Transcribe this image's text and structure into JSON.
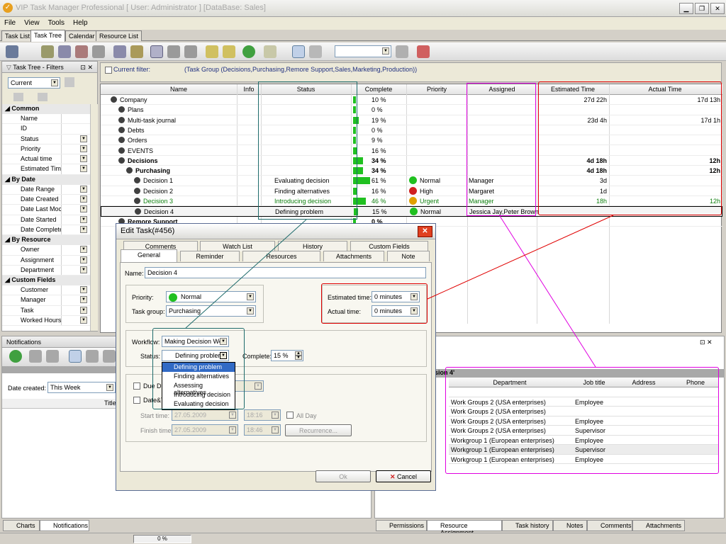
{
  "window": {
    "title": "VIP Task Manager Professional [ User: Administrator ] [DataBase: Sales]"
  },
  "menu": [
    "File",
    "View",
    "Tools",
    "Help"
  ],
  "view_tabs": [
    "Task List",
    "Task Tree",
    "Calendar",
    "Resource List"
  ],
  "filters_panel": {
    "title": "Task Tree - Filters",
    "current": "Current",
    "groups": [
      {
        "name": "Common",
        "items": [
          "Name",
          "ID",
          "Status",
          "Priority",
          "Actual time",
          "Estimated Tim"
        ]
      },
      {
        "name": "By Date",
        "items": [
          "Date Range",
          "Date Created",
          "Date Last Moc",
          "Date Started",
          "Date Complete"
        ]
      },
      {
        "name": "By Resource",
        "items": [
          "Owner",
          "Assignment",
          "Department"
        ]
      },
      {
        "name": "Custom Fields",
        "items": [
          "Customer",
          "Manager",
          "Task",
          "Worked Hours"
        ]
      }
    ]
  },
  "current_filter": {
    "label": "Current filter:",
    "value": "(Task Group  (Decisions,Purchasing,Remore Support,Sales,Marketing,Production))"
  },
  "task_grid": {
    "columns": [
      "Name",
      "Info",
      "Status",
      "Complete",
      "Priority",
      "Assigned",
      "Estimated Time",
      "Actual Time"
    ],
    "rows": [
      {
        "name": "Company",
        "status": "",
        "complete": "10 %",
        "pct": 10,
        "priority": "",
        "assigned": "",
        "est": "27d 22h",
        "act": "17d 13h",
        "bold": false,
        "indent": 0
      },
      {
        "name": "Plans",
        "status": "",
        "complete": "0 %",
        "pct": 0,
        "priority": "",
        "assigned": "",
        "est": "",
        "act": "",
        "bold": false,
        "indent": 1
      },
      {
        "name": "Multi-task journal",
        "status": "",
        "complete": "19 %",
        "pct": 19,
        "priority": "",
        "assigned": "",
        "est": "23d 4h",
        "act": "17d 1h",
        "bold": false,
        "indent": 1
      },
      {
        "name": "Debts",
        "status": "",
        "complete": "0 %",
        "pct": 0,
        "priority": "",
        "assigned": "",
        "est": "",
        "act": "",
        "bold": false,
        "indent": 1
      },
      {
        "name": "Orders",
        "status": "",
        "complete": "9 %",
        "pct": 9,
        "priority": "",
        "assigned": "",
        "est": "",
        "act": "",
        "bold": false,
        "indent": 1
      },
      {
        "name": "EVENTS",
        "status": "",
        "complete": "16 %",
        "pct": 16,
        "priority": "",
        "assigned": "",
        "est": "",
        "act": "",
        "bold": false,
        "indent": 1
      },
      {
        "name": "Decisions",
        "status": "",
        "complete": "34 %",
        "pct": 34,
        "priority": "",
        "assigned": "",
        "est": "4d 18h",
        "act": "12h",
        "bold": true,
        "indent": 1
      },
      {
        "name": "Purchasing",
        "status": "",
        "complete": "34 %",
        "pct": 34,
        "priority": "",
        "assigned": "",
        "est": "4d 18h",
        "act": "12h",
        "bold": true,
        "indent": 2
      },
      {
        "name": "Decision 1",
        "status": "Evaluating decision",
        "complete": "61 %",
        "pct": 61,
        "priority": "Normal",
        "assigned": "Manager",
        "est": "3d",
        "act": "",
        "bold": false,
        "indent": 3
      },
      {
        "name": "Decision 2",
        "status": "Finding alternatives",
        "complete": "16 %",
        "pct": 16,
        "priority": "High",
        "assigned": "Margaret",
        "est": "1d",
        "act": "",
        "bold": false,
        "indent": 3
      },
      {
        "name": "Decision 3",
        "status": "Introducing decision",
        "complete": "46 %",
        "pct": 46,
        "priority": "Urgent",
        "assigned": "Manager",
        "est": "18h",
        "act": "12h",
        "bold": false,
        "indent": 3,
        "green": true
      },
      {
        "name": "Decision 4",
        "status": "Defining problem",
        "complete": "15 %",
        "pct": 15,
        "priority": "Normal",
        "assigned": "Jessica Jay,Peter Brown",
        "est": "",
        "act": "",
        "bold": false,
        "indent": 3,
        "selected": true
      },
      {
        "name": "Remore Support",
        "status": "",
        "complete": "0 %",
        "pct": 0,
        "priority": "",
        "assigned": "",
        "est": "",
        "act": "",
        "bold": true,
        "indent": 1
      }
    ]
  },
  "notifications": {
    "title": "Notifications",
    "date_created_label": "Date created:",
    "date_created_value": "This Week",
    "col_title": "Title"
  },
  "left_bottom_tabs": [
    "Charts",
    "Notifications"
  ],
  "resource_panel": {
    "header": "sion 4'",
    "columns": [
      "Department",
      "Job title",
      "Address",
      "Phone"
    ],
    "rows": [
      {
        "dept": "",
        "job": ""
      },
      {
        "dept": "Work Groups 2 (USA enterprises)",
        "job": "Employee"
      },
      {
        "dept": "Work Groups 2 (USA enterprises)",
        "job": ""
      },
      {
        "dept": "Work Groups 2 (USA enterprises)",
        "job": "Employee"
      },
      {
        "dept": "Work Groups 2 (USA enterprises)",
        "job": "Supervisor"
      },
      {
        "dept": "Workgroup 1 (European enterprises)",
        "job": "Employee"
      },
      {
        "dept": "Workgroup 1 (European enterprises)",
        "job": "Supervisor"
      },
      {
        "dept": "Workgroup 1 (European enterprises)",
        "job": "Employee"
      }
    ],
    "tabs": [
      "Permissions",
      "Resource Assignment",
      "Task history",
      "Notes",
      "Comments",
      "Attachments"
    ]
  },
  "edit_dialog": {
    "title": "Edit Task(#456)",
    "tabs_row1": [
      "Comments",
      "Watch List",
      "History",
      "Custom Fields"
    ],
    "tabs_row2": [
      "General",
      "Reminder",
      "Resources",
      "Attachments",
      "Note"
    ],
    "name_label": "Name:",
    "name_value": "Decision 4",
    "priority_label": "Priority:",
    "priority_value": "Normal",
    "taskgroup_label": "Task group:",
    "taskgroup_value": "Purchasing",
    "est_label": "Estimated time:",
    "est_value": "0 minutes",
    "act_label": "Actual time:",
    "act_value": "0 minutes",
    "workflow_label": "Workflow:",
    "workflow_value": "Making Decision Wo",
    "status_label": "Status:",
    "status_value": "Defining probler",
    "complete_label": "Complete:",
    "complete_value": "15 %",
    "status_options": [
      "Defining problem",
      "Finding alternatives",
      "Assessing alternatives",
      "Introducing decision",
      "Evaluating decision"
    ],
    "due_label": "Due D",
    "datetime_label": "Date&T",
    "start_label": "Start time:",
    "start_date": "27.05.2009",
    "start_time": "18:16",
    "finish_label": "Finish time:",
    "finish_date": "27.05.2009",
    "finish_time": "18:46",
    "allday_label": "All Day",
    "recurrence_label": "Recurrence...",
    "ok_label": "Ok",
    "cancel_label": "Cancel"
  },
  "statusbar": {
    "progress": "0 %"
  },
  "colors": {
    "highlight_teal": "#1e6b6b",
    "highlight_magenta": "#e000e0",
    "highlight_red": "#e00000",
    "progress_green": "#20c020"
  }
}
